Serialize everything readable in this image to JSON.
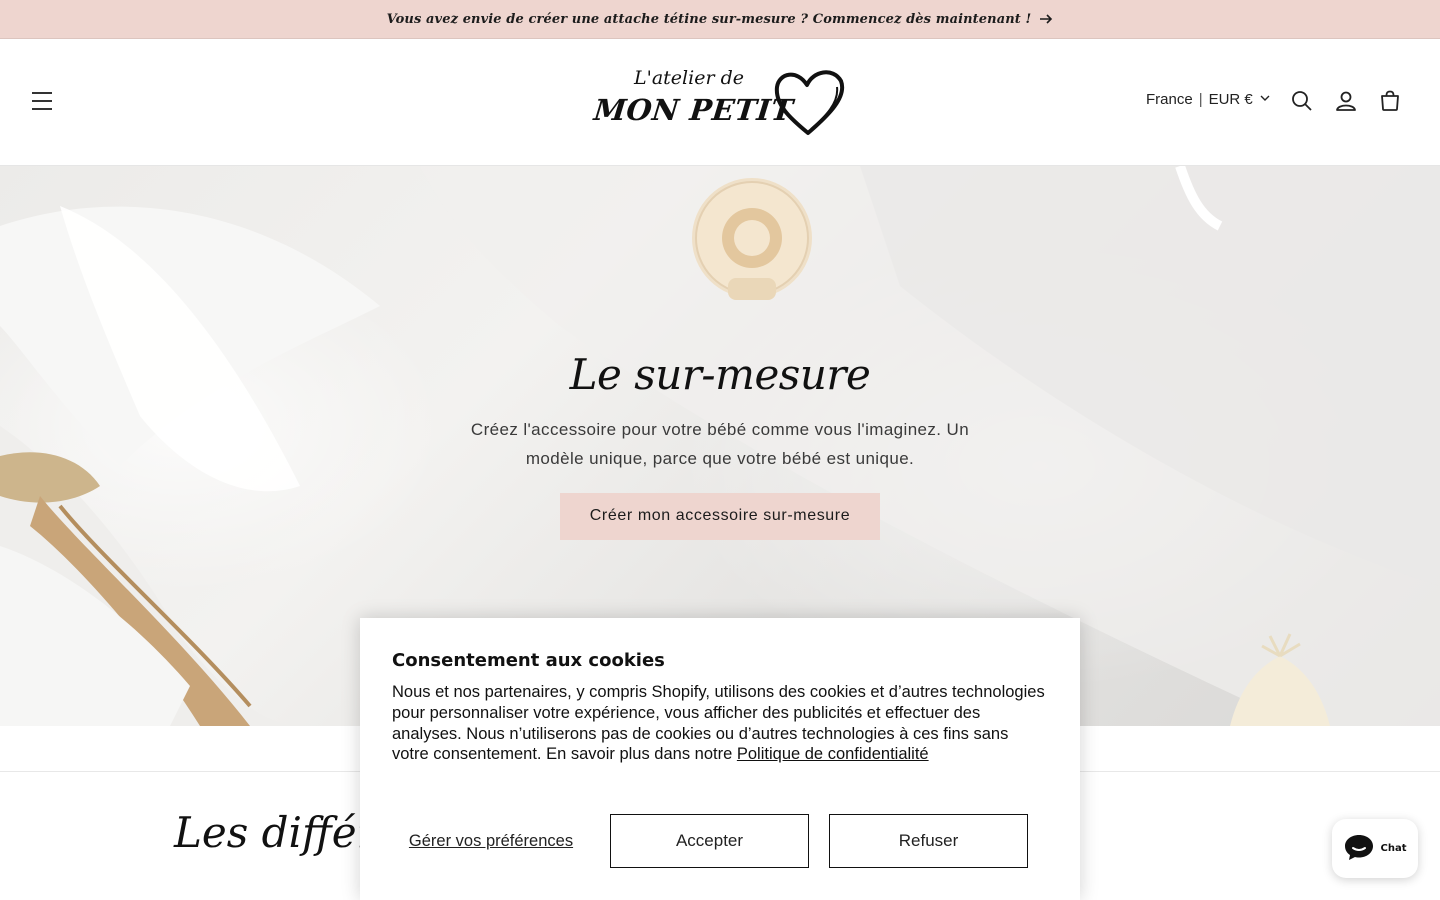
{
  "announcement": {
    "text": "Vous avez envie de créer une attache tétine sur-mesure ? Commencez dès maintenant !",
    "arrow_icon": "arrow-right-icon"
  },
  "header": {
    "menu_icon": "hamburger-menu-icon",
    "logo": {
      "line1": "L'atelier de",
      "line2": "MON PETIT",
      "heart_icon": "heart-icon"
    },
    "locale": {
      "country": "France",
      "separator": "|",
      "currency": "EUR €"
    },
    "icons": [
      "search-icon",
      "account-icon",
      "cart-icon"
    ]
  },
  "hero": {
    "title": "Le sur-mesure",
    "text": "Créez l'accessoire pour votre bébé comme vous l'imaginez. Un modèle unique, parce que votre bébé est unique.",
    "button_label": "Créer mon accessoire sur-mesure"
  },
  "section": {
    "heading": "Les différen"
  },
  "cookie_banner": {
    "title": "Consentement aux cookies",
    "body": "Nous et nos partenaires, y compris Shopify, utilisons des cookies et d’autres technologies pour personnaliser votre expérience, vous afficher des publicités et effectuer des analyses. Nous n’utiliserons pas de cookies ou d’autres technologies à ces fins sans votre consentement. En savoir plus dans notre",
    "policy_link": "Politique de confidentialité",
    "preferences_label": "Gérer vos préférences",
    "accept_label": "Accepter",
    "refuse_label": "Refuser"
  },
  "chat": {
    "label": "Chat",
    "icon": "chat-bubble-icon"
  },
  "colors": {
    "accent_pink": "#eed5cf",
    "text": "#121212"
  }
}
